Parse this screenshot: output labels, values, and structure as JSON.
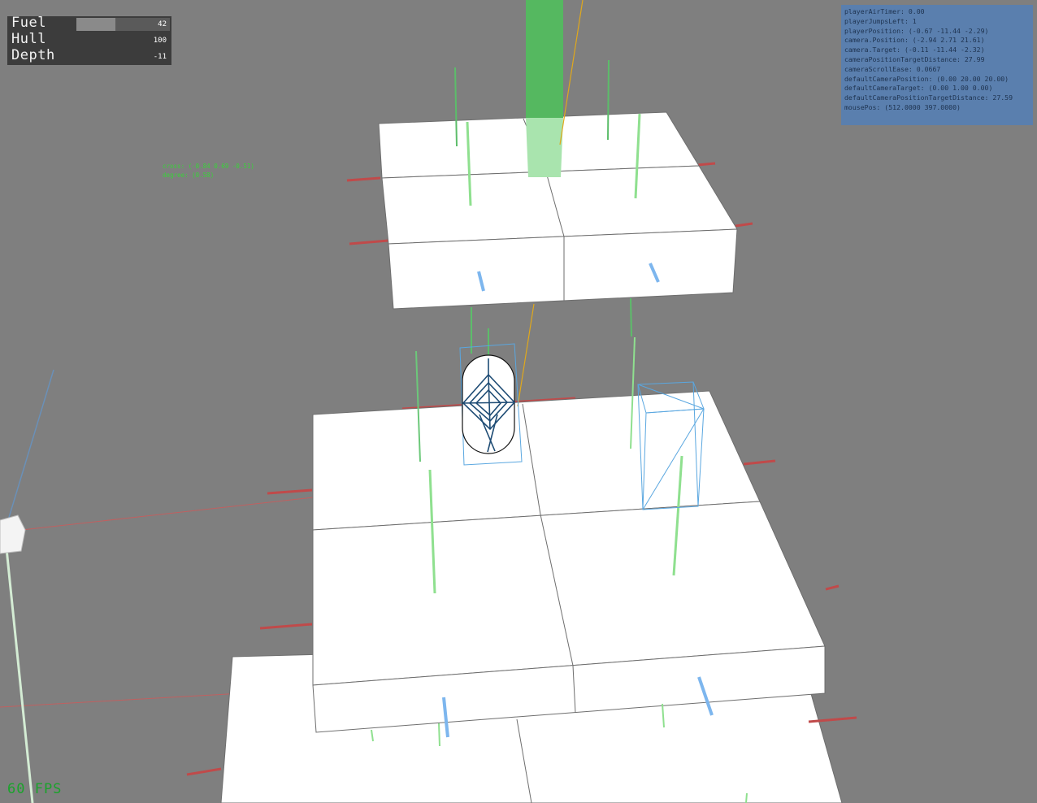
{
  "hud": {
    "fuel_label": "Fuel",
    "fuel_value": "42",
    "fuel_fraction": 0.42,
    "hull_label": "Hull",
    "hull_value": "100",
    "hull_fraction": 0.0,
    "depth_label": "Depth",
    "depth_value": "-11",
    "depth_fraction": 0.0
  },
  "debug": {
    "lines": [
      "playerAirTimer: 0.00",
      "playerJumpsLeft: 1",
      "playerPosition: (-0.67 -11.44 -2.29)",
      "camera.Position: (-2.94 2.71 21.61)",
      "camera.Target: (-0.11 -11.44 -2.32)",
      "cameraPositionTargetDistance: 27.99",
      "cameraScrollEase: 0.0667",
      "defaultCameraPosition: (0.00 20.00 20.00)",
      "defaultCameraTarget: (0.00 1.00 0.00)",
      "defaultCameraPositionTargetDistance: 27.59",
      "mousePos: (512.0000 397.0000)"
    ]
  },
  "notes": {
    "cross": "cross: (-0.84 0.69 -0.51)",
    "degree": "degree: (0.58)"
  },
  "fps": "60 FPS",
  "colors": {
    "background": "#7f7f7f",
    "block_face": "#ffffff",
    "block_edge": "#6e6e6e",
    "axis_x": "#c04a4a",
    "axis_y": "#8fe08f",
    "axis_z": "#7db6ee",
    "wire": "#5aa7e0",
    "beam": "#5cc86a",
    "ray": "#e0a81c",
    "fps": "#1aa32b"
  }
}
